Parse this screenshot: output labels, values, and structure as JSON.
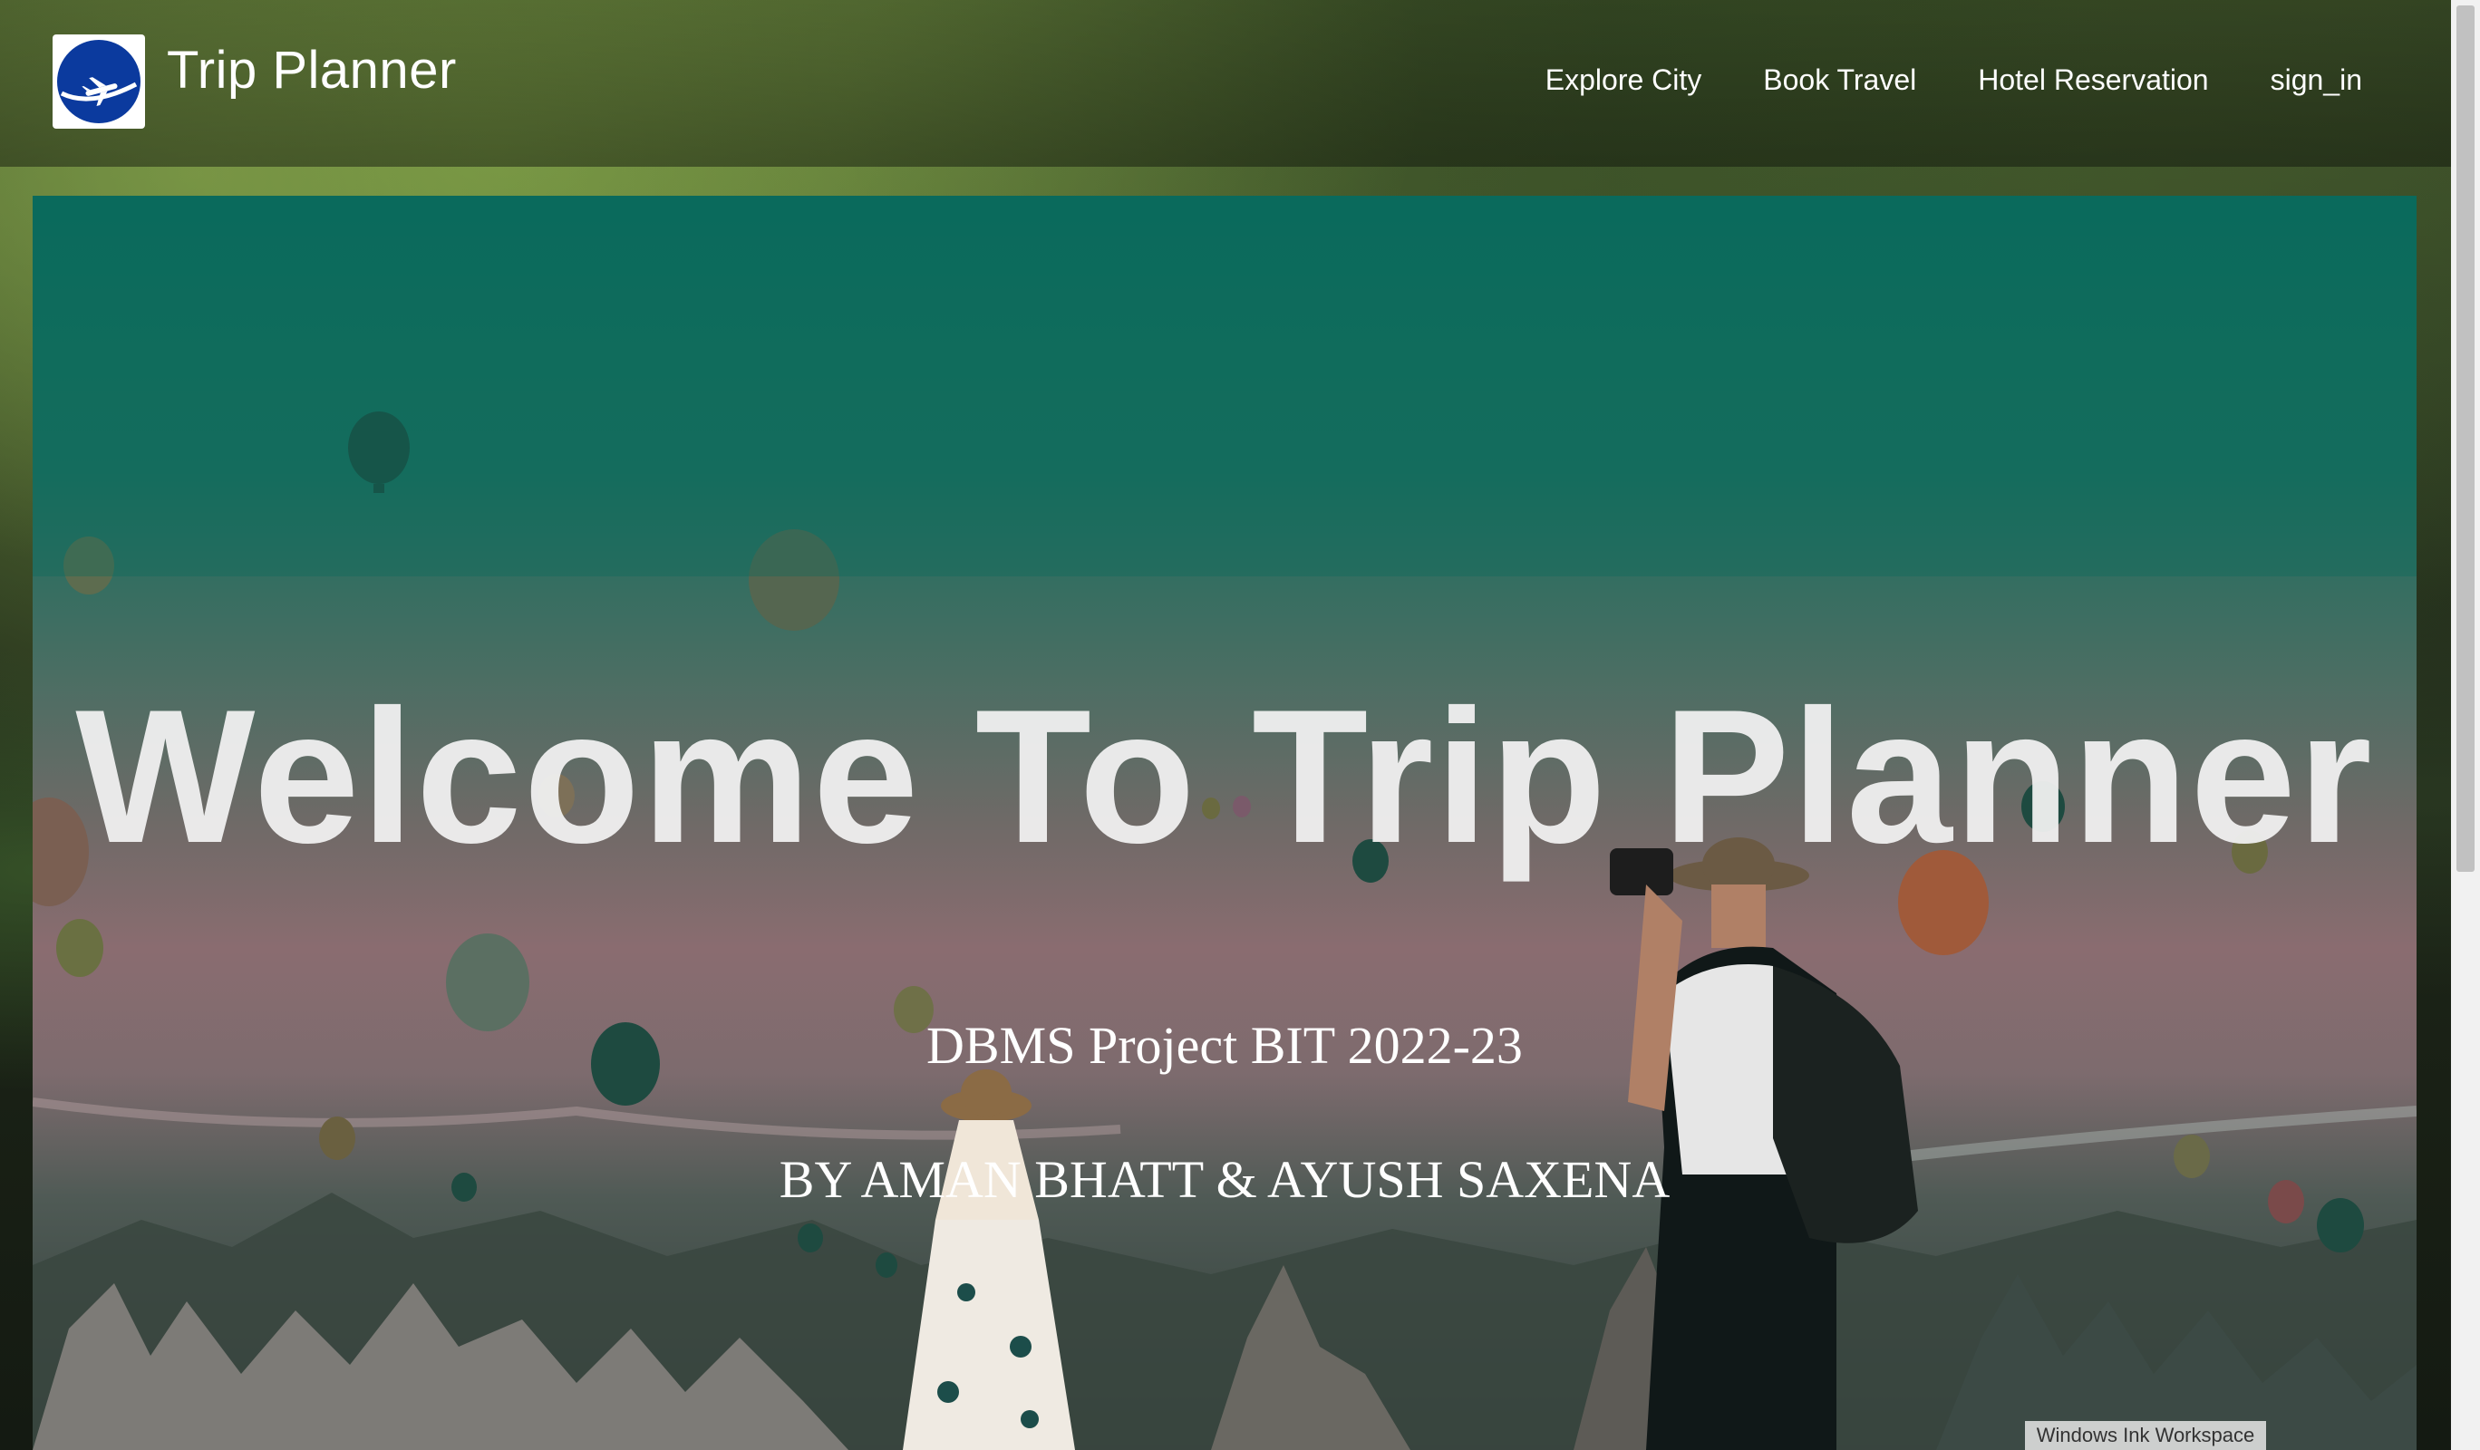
{
  "header": {
    "brand": "Trip Planner",
    "nav": [
      {
        "label": "Explore City"
      },
      {
        "label": "Book Travel"
      },
      {
        "label": "Hotel Reservation"
      },
      {
        "label": "sign_in"
      }
    ]
  },
  "hero": {
    "title": "Welcome To Trip Planner",
    "subtitle": "DBMS Project BIT 2022-23",
    "authors": "BY AMAN BHATT & AYUSH SAXENA"
  },
  "system": {
    "ink_workspace": "Windows Ink Workspace"
  },
  "colors": {
    "logo_blue": "#0b3a9e",
    "hero_teal": "#0b6b5c",
    "text": "#ffffff"
  }
}
